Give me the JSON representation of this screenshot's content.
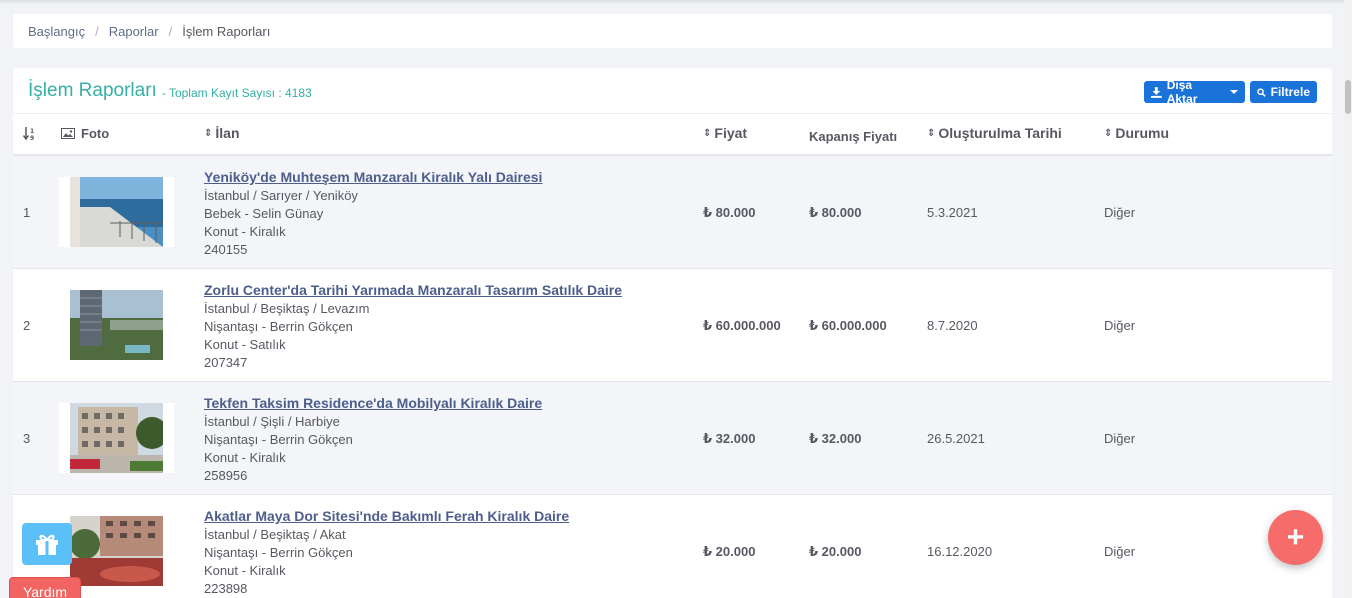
{
  "breadcrumb": {
    "home": "Başlangıç",
    "reports": "Raporlar",
    "current": "İşlem Raporları",
    "separator": "/"
  },
  "panel": {
    "title": "İşlem Raporları",
    "subtitle": "- Toplam Kayıt Sayısı : 4183",
    "export_label": "Dışa Aktar",
    "filter_label": "Filtrele"
  },
  "table": {
    "columns": {
      "photo": "Foto",
      "listing": "İlan",
      "price": "Fiyat",
      "closing_price": "Kapanış Fiyatı",
      "created_date": "Oluşturulma Tarihi",
      "status": "Durumu"
    },
    "rows": [
      {
        "index": "1",
        "title": "Yeniköy'de Muhteşem Manzaralı Kiralık Yalı Dairesi",
        "location": "İstanbul / Sarıyer / Yeniköy",
        "office": "Bebek - Selin Günay",
        "type": "Konut - Kiralık",
        "code": "240155",
        "price": "₺ 80.000",
        "closing_price": "₺ 80.000",
        "date": "5.3.2021",
        "status": "Diğer"
      },
      {
        "index": "2",
        "title": "Zorlu Center'da Tarihi Yarımada Manzaralı Tasarım Satılık Daire",
        "location": "İstanbul / Beşiktaş / Levazım",
        "office": "Nişantaşı - Berrin Gökçen",
        "type": "Konut - Satılık",
        "code": "207347",
        "price": "₺ 60.000.000",
        "closing_price": "₺ 60.000.000",
        "date": "8.7.2020",
        "status": "Diğer"
      },
      {
        "index": "3",
        "title": "Tekfen Taksim Residence'da Mobilyalı Kiralık Daire",
        "location": "İstanbul / Şişli / Harbiye",
        "office": "Nişantaşı - Berrin Gökçen",
        "type": "Konut - Kiralık",
        "code": "258956",
        "price": "₺ 32.000",
        "closing_price": "₺ 32.000",
        "date": "26.5.2021",
        "status": "Diğer"
      },
      {
        "index": "",
        "title": "Akatlar Maya Dor Sitesi'nde Bakımlı Ferah Kiralık Daire",
        "location": "İstanbul / Beşiktaş / Akat",
        "office": "Nişantaşı - Berrin Gökçen",
        "type": "Konut - Kiralık",
        "code": "223898",
        "price": "₺ 20.000",
        "closing_price": "₺ 20.000",
        "date": "16.12.2020",
        "status": "Diğer"
      }
    ]
  },
  "widgets": {
    "help_label": "Yardım",
    "fab_symbol": "+",
    "gift_icon": "gift-icon"
  },
  "colors": {
    "accent_teal": "#35b0a6",
    "button_blue": "#1a73d9",
    "fab_red": "#f56c6a",
    "link_title": "#4d5e8c"
  }
}
